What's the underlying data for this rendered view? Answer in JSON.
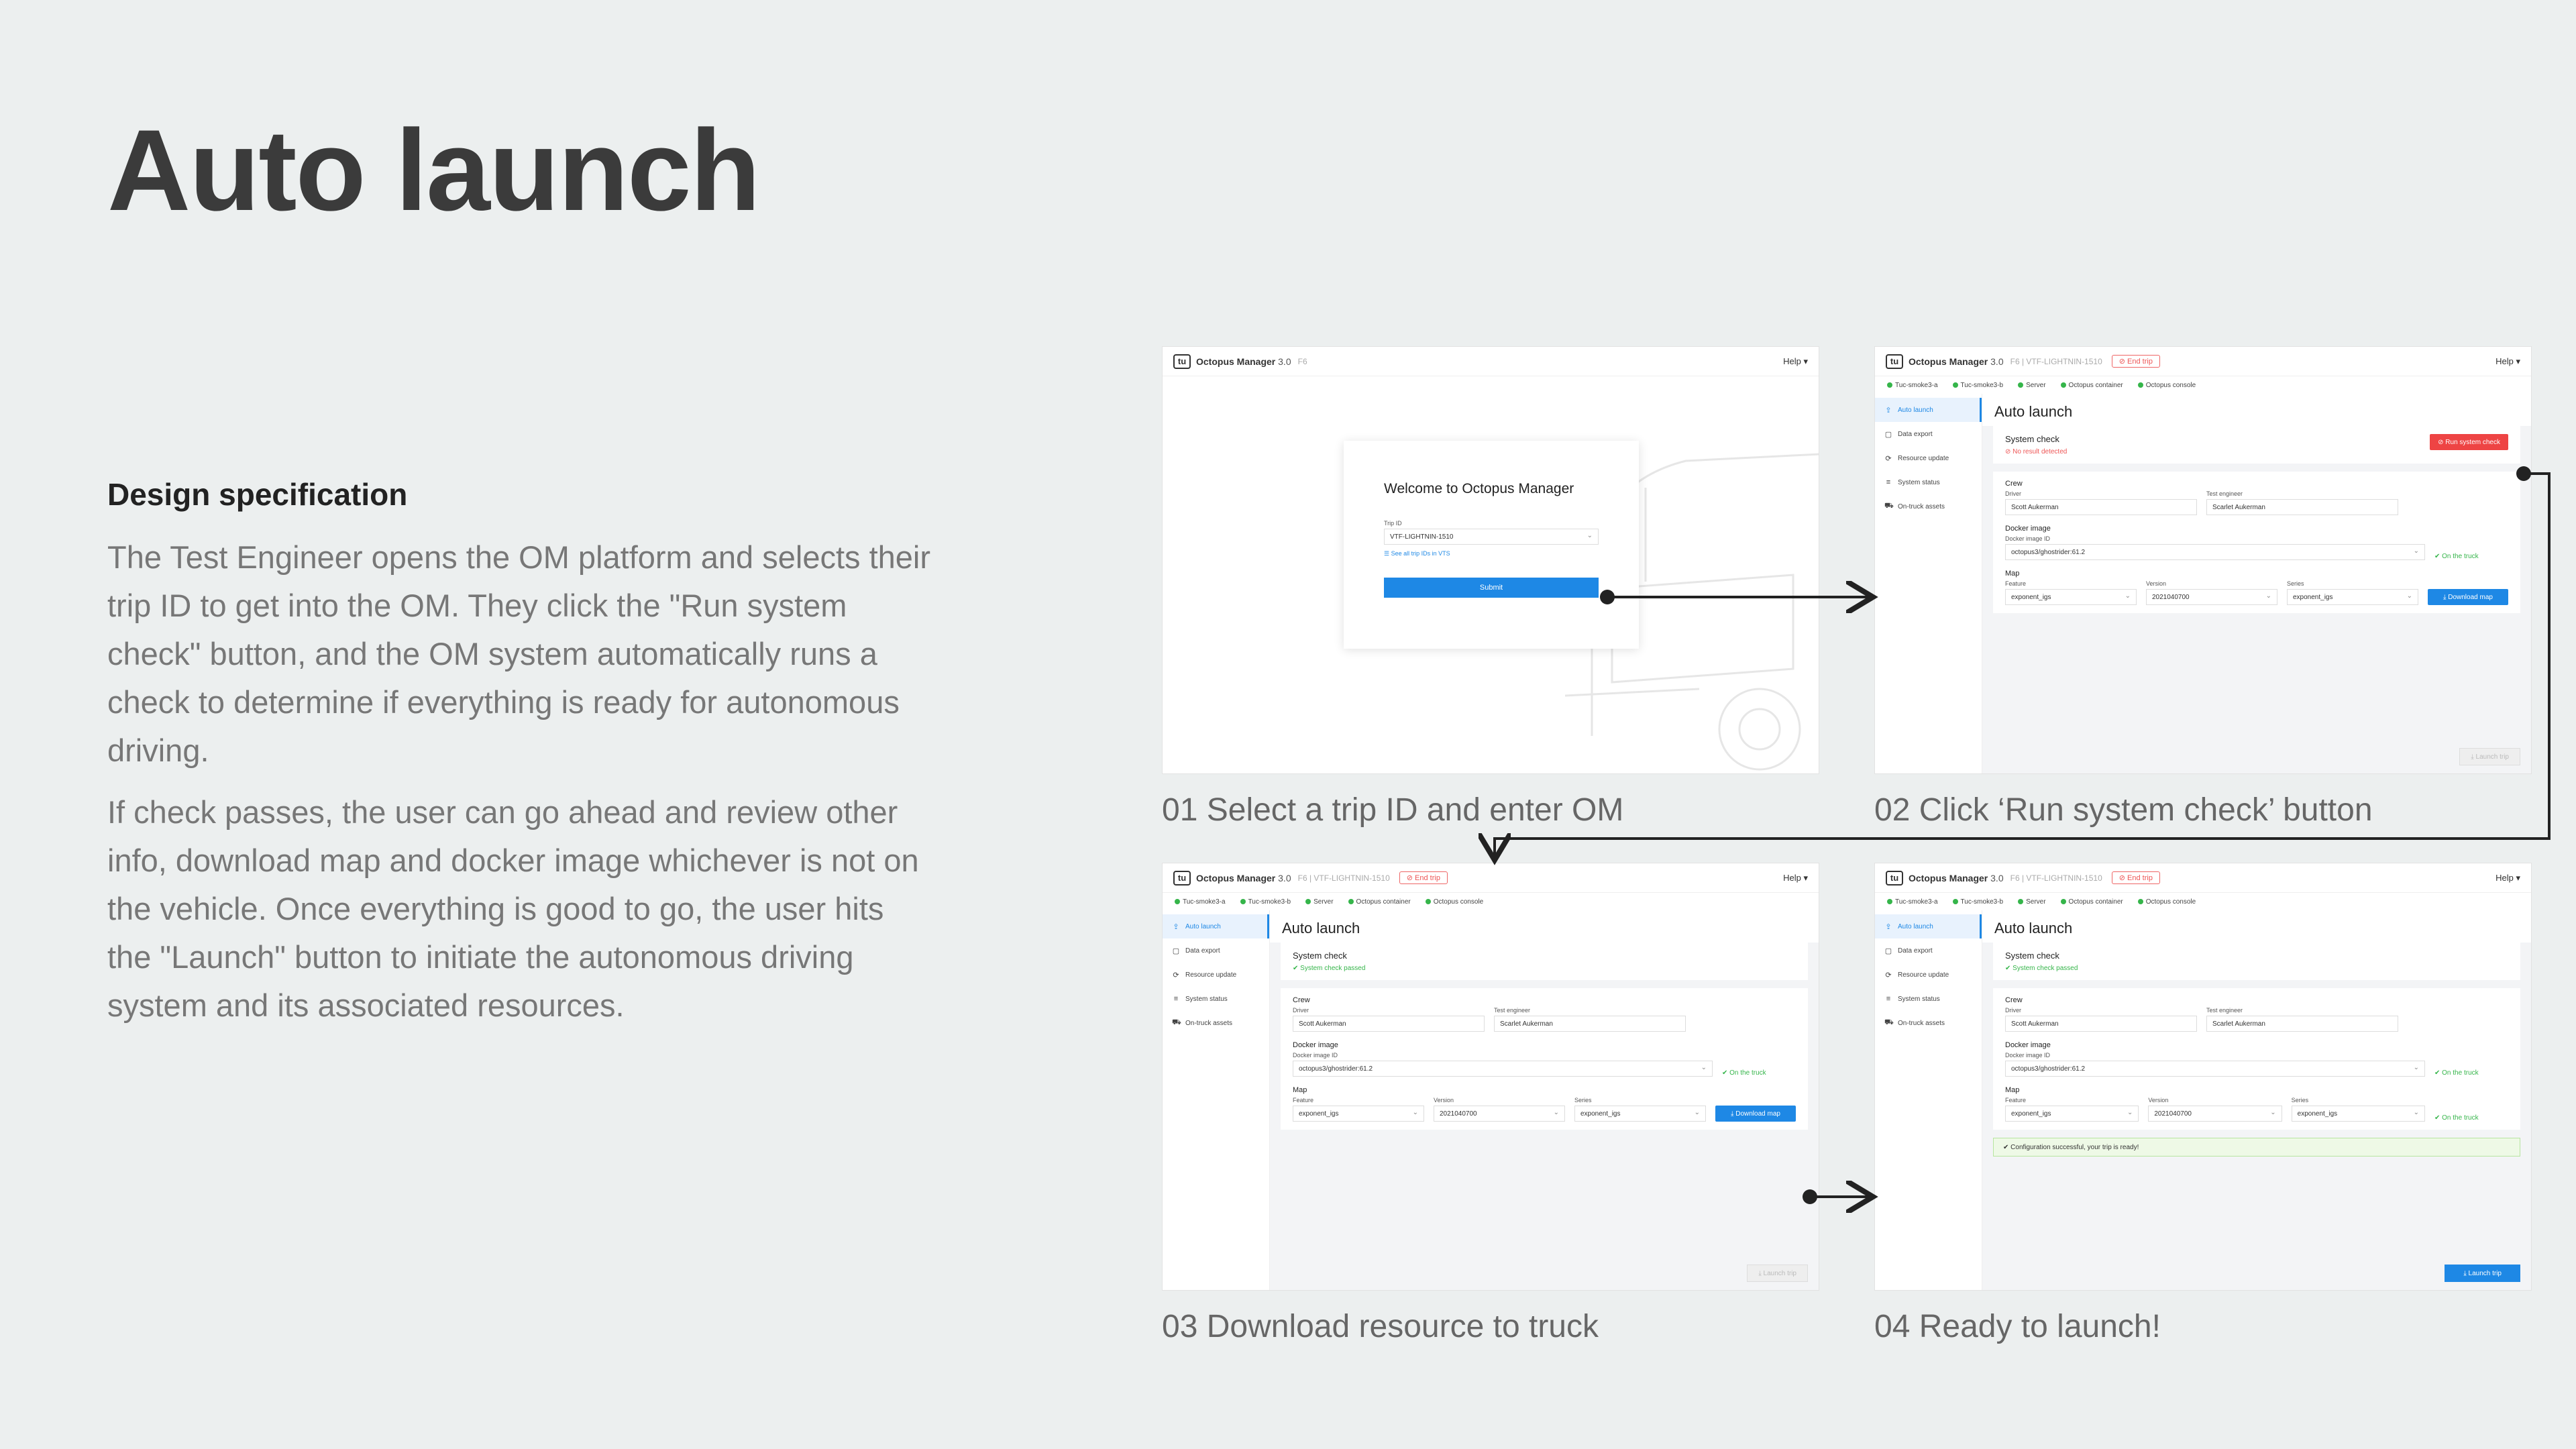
{
  "page": {
    "title": "Auto launch",
    "spec_heading": "Design specification",
    "spec_p1": "The Test Engineer opens the OM platform and selects their trip ID to get into the OM. They click the \"Run system check\" button, and the OM system automatically runs a check to determine if everything is ready for autonomous driving.",
    "spec_p2": "If check passes, the user can go ahead and review other info, download map and docker image whichever is not on the vehicle. Once everything is good to go, the user hits the \"Launch\" button to initiate the autonomous driving system and its associated resources."
  },
  "captions": {
    "s1": "01 Select a trip ID and enter OM",
    "s2": "02 Click ‘Run system check’ button",
    "s3": "03 Download resource to truck",
    "s4": "04 Ready to launch!"
  },
  "om": {
    "logo": "tu",
    "app_name": "Octopus Manager",
    "version": "3.0",
    "trip_short": "F6",
    "trip_full": "F6 | VTF-LIGHTNIN-1510",
    "end_trip": "⊘ End trip",
    "help": "Help ▾",
    "status": [
      "Tuc-smoke3-a",
      "Tuc-smoke3-b",
      "Server",
      "Octopus container",
      "Octopus console"
    ],
    "sidebar": [
      "Auto launch",
      "Data export",
      "Resource update",
      "System status",
      "On-truck assets"
    ],
    "main_title": "Auto launch",
    "system_check": "System check",
    "no_result": "⊘ No result detected",
    "check_passed": "✔ System check passed",
    "run_check": "⊘ Run system check",
    "crew": "Crew",
    "driver_label": "Driver",
    "driver": "Scott Aukerman",
    "engineer_label": "Test engineer",
    "engineer": "Scarlet Aukerman",
    "docker_title": "Docker image",
    "docker_label": "Docker image ID",
    "docker_value": "octopus3/ghostrider:61.2",
    "on_truck": "✔ On the truck",
    "map_title": "Map",
    "feature_label": "Feature",
    "feature": "exponent_igs",
    "version_label": "Version",
    "version_value": "2021040700",
    "series_label": "Series",
    "series": "exponent_igs",
    "download_map": "⤓ Download map",
    "launch_trip": "⤓ Launch trip",
    "config_success": "✔ Configuration successful, your trip is ready!",
    "welcome": "Welcome to Octopus Manager",
    "trip_id_label": "Trip ID",
    "trip_id_value": "VTF-LIGHTNIN-1510",
    "see_all": "☰ See all trip IDs in VTS",
    "submit": "Submit"
  }
}
